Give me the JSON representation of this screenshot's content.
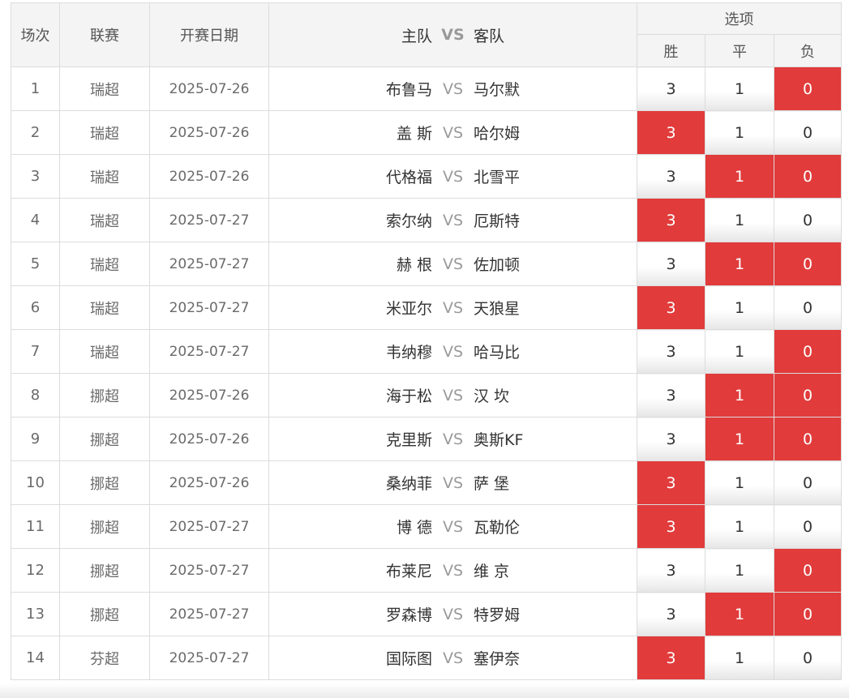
{
  "header": {
    "col_no": "场次",
    "col_league": "联赛",
    "col_date": "开赛日期",
    "col_home": "主队",
    "col_vs": "VS",
    "col_away": "客队",
    "col_options": "选项",
    "opt_win": "胜",
    "opt_draw": "平",
    "opt_lose": "负"
  },
  "colors": {
    "selected": "#e13b3b",
    "vs_text": "#999999",
    "border": "#dcdcdc"
  },
  "rows": [
    {
      "no": "1",
      "league": "瑞超",
      "date": "2025-07-26",
      "home": "布鲁马",
      "vs": "VS",
      "away": "马尔默",
      "win": "3",
      "draw": "1",
      "lose": "0",
      "selected": [
        "lose"
      ]
    },
    {
      "no": "2",
      "league": "瑞超",
      "date": "2025-07-26",
      "home": "盖 斯",
      "vs": "VS",
      "away": "哈尔姆",
      "win": "3",
      "draw": "1",
      "lose": "0",
      "selected": [
        "win"
      ]
    },
    {
      "no": "3",
      "league": "瑞超",
      "date": "2025-07-26",
      "home": "代格福",
      "vs": "VS",
      "away": "北雪平",
      "win": "3",
      "draw": "1",
      "lose": "0",
      "selected": [
        "draw",
        "lose"
      ]
    },
    {
      "no": "4",
      "league": "瑞超",
      "date": "2025-07-27",
      "home": "索尔纳",
      "vs": "VS",
      "away": "厄斯特",
      "win": "3",
      "draw": "1",
      "lose": "0",
      "selected": [
        "win"
      ]
    },
    {
      "no": "5",
      "league": "瑞超",
      "date": "2025-07-27",
      "home": "赫 根",
      "vs": "VS",
      "away": "佐加顿",
      "win": "3",
      "draw": "1",
      "lose": "0",
      "selected": [
        "draw",
        "lose"
      ]
    },
    {
      "no": "6",
      "league": "瑞超",
      "date": "2025-07-27",
      "home": "米亚尔",
      "vs": "VS",
      "away": "天狼星",
      "win": "3",
      "draw": "1",
      "lose": "0",
      "selected": [
        "win"
      ]
    },
    {
      "no": "7",
      "league": "瑞超",
      "date": "2025-07-27",
      "home": "韦纳穆",
      "vs": "VS",
      "away": "哈马比",
      "win": "3",
      "draw": "1",
      "lose": "0",
      "selected": [
        "lose"
      ]
    },
    {
      "no": "8",
      "league": "挪超",
      "date": "2025-07-26",
      "home": "海于松",
      "vs": "VS",
      "away": "汉 坎",
      "win": "3",
      "draw": "1",
      "lose": "0",
      "selected": [
        "draw",
        "lose"
      ]
    },
    {
      "no": "9",
      "league": "挪超",
      "date": "2025-07-26",
      "home": "克里斯",
      "vs": "VS",
      "away": "奥斯KF",
      "win": "3",
      "draw": "1",
      "lose": "0",
      "selected": [
        "draw",
        "lose"
      ]
    },
    {
      "no": "10",
      "league": "挪超",
      "date": "2025-07-26",
      "home": "桑纳菲",
      "vs": "VS",
      "away": "萨 堡",
      "win": "3",
      "draw": "1",
      "lose": "0",
      "selected": [
        "win"
      ]
    },
    {
      "no": "11",
      "league": "挪超",
      "date": "2025-07-27",
      "home": "博 德",
      "vs": "VS",
      "away": "瓦勒伦",
      "win": "3",
      "draw": "1",
      "lose": "0",
      "selected": [
        "win"
      ]
    },
    {
      "no": "12",
      "league": "挪超",
      "date": "2025-07-27",
      "home": "布莱尼",
      "vs": "VS",
      "away": "维 京",
      "win": "3",
      "draw": "1",
      "lose": "0",
      "selected": [
        "lose"
      ]
    },
    {
      "no": "13",
      "league": "挪超",
      "date": "2025-07-27",
      "home": "罗森博",
      "vs": "VS",
      "away": "特罗姆",
      "win": "3",
      "draw": "1",
      "lose": "0",
      "selected": [
        "draw",
        "lose"
      ]
    },
    {
      "no": "14",
      "league": "芬超",
      "date": "2025-07-27",
      "home": "国际图",
      "vs": "VS",
      "away": "塞伊奈",
      "win": "3",
      "draw": "1",
      "lose": "0",
      "selected": [
        "win"
      ]
    }
  ]
}
